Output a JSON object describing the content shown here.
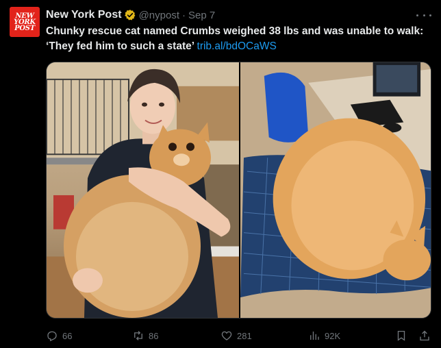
{
  "account": {
    "avatar_text": "NEW\nYORK\nPOST",
    "name": "New York Post",
    "handle": "@nypost",
    "separator": "·",
    "date": "Sep 7"
  },
  "tweet": {
    "text": "Chunky rescue cat named Crumbs weighed 38 lbs and was unable to walk: ‘They fed him to such a state’",
    "link": "trib.al/bdOCaWS"
  },
  "media": {
    "left_photo": "woman holding orange cat",
    "right_photo": "orange cat lying on blue cloth"
  },
  "actions": {
    "reply_count": "66",
    "repost_count": "86",
    "like_count": "281",
    "view_count": "92K"
  },
  "colors": {
    "brand_red": "#e2231a",
    "link_blue": "#1d9bf0",
    "verified_gold": "#e2b719",
    "muted": "#71767b"
  }
}
